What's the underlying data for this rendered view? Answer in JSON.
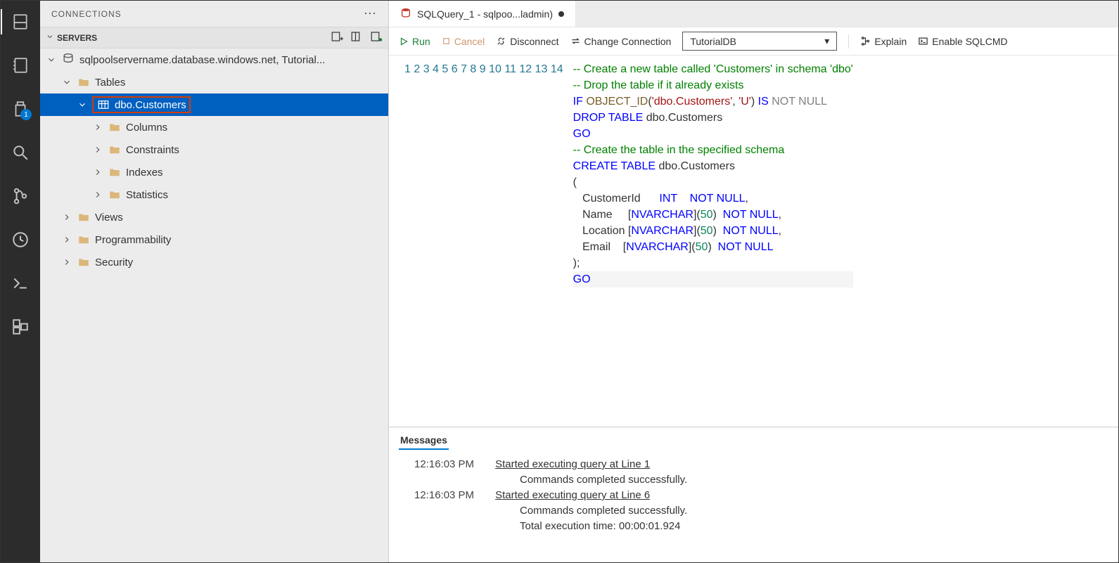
{
  "activity": {
    "explorer_badge": "1"
  },
  "panel": {
    "title": "CONNECTIONS",
    "section": "SERVERS",
    "server": "sqlpoolservername.database.windows.net, Tutorial...",
    "tree": {
      "tables": "Tables",
      "customers": "dbo.Customers",
      "columns": "Columns",
      "constraints": "Constraints",
      "indexes": "Indexes",
      "statistics": "Statistics",
      "views": "Views",
      "programmability": "Programmability",
      "security": "Security"
    }
  },
  "tab": {
    "label": "SQLQuery_1 - sqlpoo...ladmin)"
  },
  "toolbar": {
    "run": "Run",
    "cancel": "Cancel",
    "disconnect": "Disconnect",
    "change_conn": "Change Connection",
    "database": "TutorialDB",
    "explain": "Explain",
    "sqlcmd": "Enable SQLCMD"
  },
  "code_lines": 14,
  "messages": {
    "title": "Messages",
    "t1": "12:16:03 PM",
    "m1": "Started executing query at Line 1",
    "m2": "Commands completed successfully.",
    "t2": "12:16:03 PM",
    "m3": "Started executing query at Line 6",
    "m4": "Commands completed successfully.",
    "m5": "Total execution time: 00:00:01.924"
  }
}
